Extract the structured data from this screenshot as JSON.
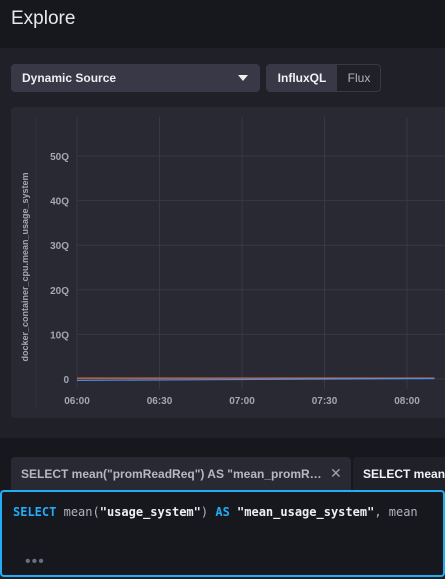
{
  "header": {
    "title": "Explore"
  },
  "source": {
    "label": "Dynamic Source"
  },
  "query_language": {
    "options": [
      "InfluxQL",
      "Flux"
    ],
    "selected": "InfluxQL"
  },
  "chart_data": {
    "type": "line",
    "ylabel": "docker_container_cpu.mean_usage_system",
    "xlabel": "",
    "y_ticks": [
      "0",
      "10Q",
      "20Q",
      "30Q",
      "40Q",
      "50Q"
    ],
    "x_ticks": [
      "06:00",
      "06:30",
      "07:00",
      "07:30",
      "08:00"
    ],
    "ylim": [
      0,
      50
    ],
    "series": [
      {
        "color": "#e06b3c",
        "x": [
          "06:00",
          "08:10"
        ],
        "y": [
          0.2,
          0.2
        ]
      },
      {
        "color": "#4591ed",
        "x": [
          "06:00",
          "08:10"
        ],
        "y": [
          -0.3,
          0.1
        ]
      }
    ],
    "grid": true
  },
  "tabs": [
    {
      "label": "SELECT mean(\"promReadReq\") AS \"mean_promR…",
      "active": false
    },
    {
      "label": "SELECT mean",
      "active": true
    }
  ],
  "editor": {
    "kw_select": "SELECT",
    "fn_mean": "mean(",
    "field": "\"usage_system\"",
    "paren": ")",
    "kw_as": "AS",
    "alias": "\"mean_usage_system\"",
    "rest": ", mean",
    "dots": "•••"
  },
  "colors": {
    "accent": "#22adf6",
    "background": "#202028",
    "panel": "#292933"
  }
}
